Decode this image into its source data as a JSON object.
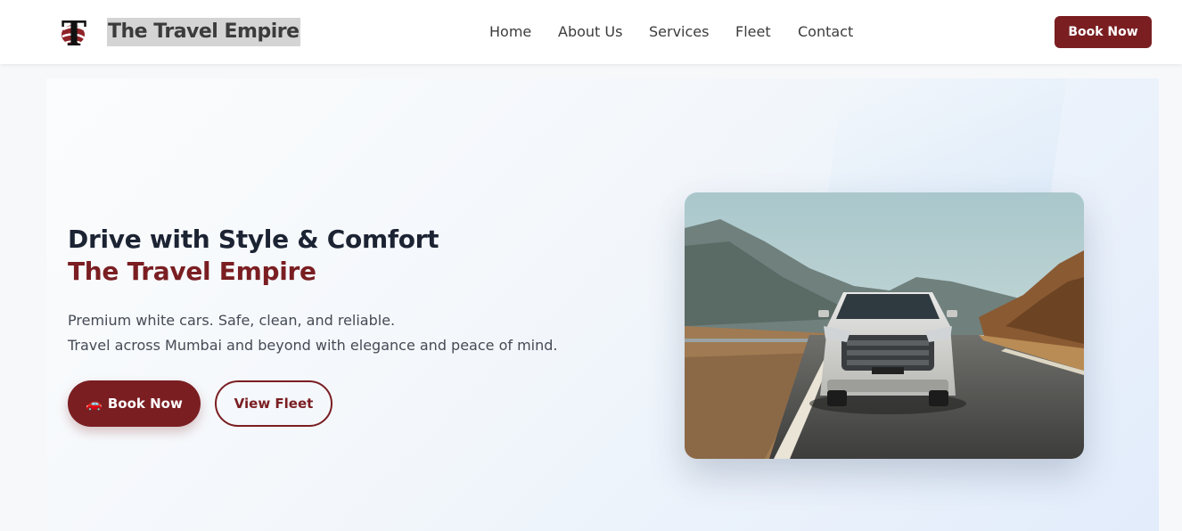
{
  "header": {
    "brand_name": "The Travel Empire",
    "logo_letter": "T",
    "nav": [
      {
        "label": "Home"
      },
      {
        "label": "About Us"
      },
      {
        "label": "Services"
      },
      {
        "label": "Fleet"
      },
      {
        "label": "Contact"
      }
    ],
    "cta_label": "Book Now"
  },
  "hero": {
    "headline": "Drive with Style & Comfort",
    "headline_accent": "The Travel Empire",
    "lines": [
      "Premium white cars. Safe, clean, and reliable.",
      "Travel across Mumbai and beyond with elegance and peace of mind."
    ],
    "primary_button": {
      "icon": "🚗",
      "label": "Book Now"
    },
    "secondary_button": {
      "label": "View Fleet"
    },
    "image_icon": "car-photo-icon"
  },
  "colors": {
    "brand": "#7a1e22",
    "text_dark": "#1c2333",
    "hero_bg": "#eef3f9"
  }
}
